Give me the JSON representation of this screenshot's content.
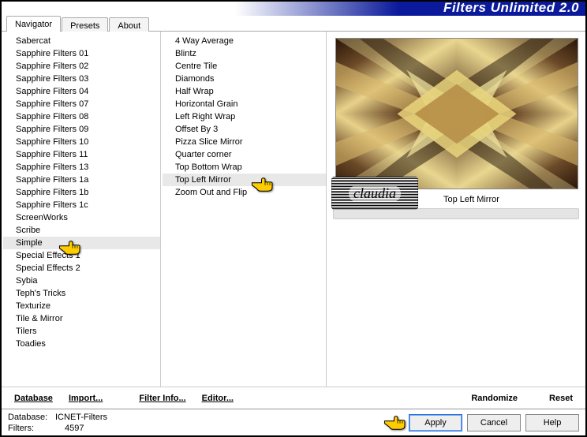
{
  "title": "Filters Unlimited 2.0",
  "tabs": [
    "Navigator",
    "Presets",
    "About"
  ],
  "active_tab": 0,
  "categories": [
    "Sabercat",
    "Sapphire Filters 01",
    "Sapphire Filters 02",
    "Sapphire Filters 03",
    "Sapphire Filters 04",
    "Sapphire Filters 07",
    "Sapphire Filters 08",
    "Sapphire Filters 09",
    "Sapphire Filters 10",
    "Sapphire Filters 11",
    "Sapphire Filters 13",
    "Sapphire Filters 1a",
    "Sapphire Filters 1b",
    "Sapphire Filters 1c",
    "ScreenWorks",
    "Scribe",
    "Simple",
    "Special Effects 1",
    "Special Effects 2",
    "Sybia",
    "Teph's Tricks",
    "Texturize",
    "Tile & Mirror",
    "Tilers",
    "Toadies"
  ],
  "selected_category_index": 16,
  "filters": [
    "4 Way Average",
    "Blintz",
    "Centre Tile",
    "Diamonds",
    "Half Wrap",
    "Horizontal Grain",
    "Left Right Wrap",
    "Offset By 3",
    "Pizza Slice Mirror",
    "Quarter corner",
    "Top Bottom Wrap",
    "Top Left Mirror",
    "Zoom Out and Flip"
  ],
  "selected_filter_index": 11,
  "current_filter_label": "Top Left Mirror",
  "watermark": "claudia",
  "toolbar": {
    "database": "Database",
    "import": "Import...",
    "filter_info": "Filter Info...",
    "editor": "Editor...",
    "randomize": "Randomize",
    "reset": "Reset"
  },
  "info": {
    "db_label": "Database:",
    "db_value": "ICNET-Filters",
    "filters_label": "Filters:",
    "filters_value": "4597"
  },
  "buttons": {
    "apply": "Apply",
    "cancel": "Cancel",
    "help": "Help"
  }
}
